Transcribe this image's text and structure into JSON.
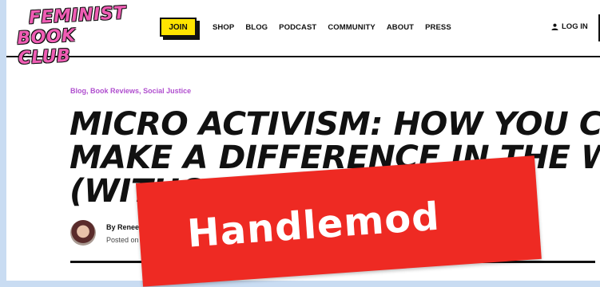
{
  "header": {
    "logo_line1": "FEMINIST",
    "logo_line2": "BOOK CLUB",
    "join_label": "JOIN",
    "nav": [
      "SHOP",
      "BLOG",
      "PODCAST",
      "COMMUNITY",
      "ABOUT",
      "PRESS"
    ],
    "login_label": "LOG IN"
  },
  "article": {
    "categories": [
      "Blog",
      "Book Reviews",
      "Social Justice"
    ],
    "title_lines": [
      "MICRO ACTIVISM: HOW YOU CAN",
      "MAKE A DIFFERENCE IN THE WORLD",
      "(WITHOUT A BULLHORN)"
    ],
    "author": "By Renee",
    "posted": "Posted on"
  },
  "overlay": {
    "text": "Handlemod",
    "color": "#ee2a23"
  },
  "colors": {
    "accent_pink": "#ef5db4",
    "join_yellow": "#ffe400",
    "category_purple": "#b04fcf",
    "frame_blue": "#c9dcf2"
  }
}
